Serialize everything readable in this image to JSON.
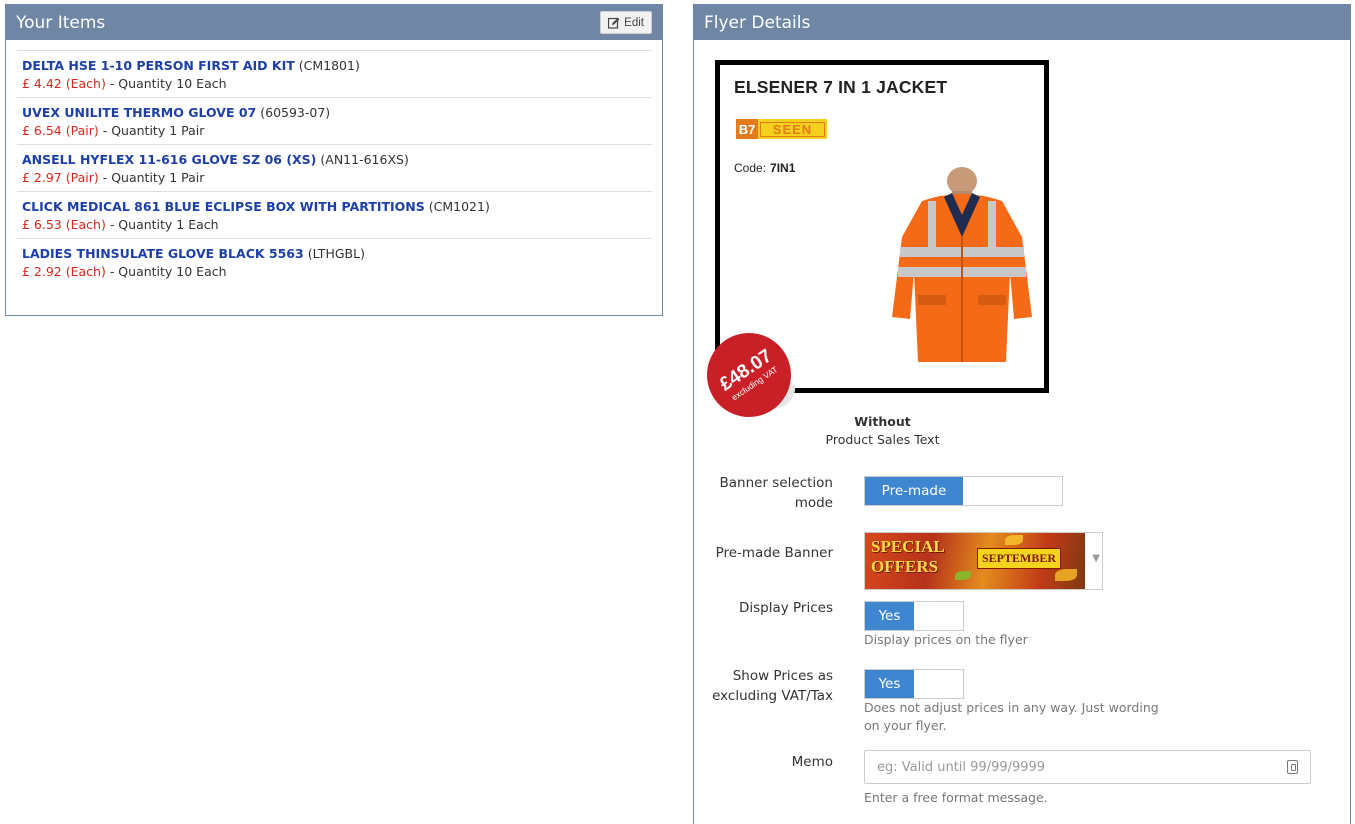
{
  "items_panel": {
    "title": "Your Items",
    "edit_label": "Edit",
    "items": [
      {
        "name": "DELTA HSE 1-10 PERSON FIRST AID KIT",
        "code": "(CM1801)",
        "price": "£ 4.42 (Each)",
        "qty": "- Quantity 10 Each"
      },
      {
        "name": "UVEX UNILITE THERMO GLOVE 07",
        "code": "(60593-07)",
        "price": "£ 6.54 (Pair)",
        "qty": "- Quantity 1 Pair"
      },
      {
        "name": "ANSELL HYFLEX 11-616 GLOVE SZ 06 (XS)",
        "code": "(AN11-616XS)",
        "price": "£ 2.97 (Pair)",
        "qty": "- Quantity 1 Pair"
      },
      {
        "name": "CLICK MEDICAL 861 BLUE ECLIPSE BOX WITH PARTITIONS",
        "code": "(CM1021)",
        "price": "£ 6.53 (Each)",
        "qty": "- Quantity 1 Each"
      },
      {
        "name": "LADIES THINSULATE GLOVE BLACK 5563",
        "code": "(LTHGBL)",
        "price": "£ 2.92 (Each)",
        "qty": "- Quantity 10 Each"
      }
    ]
  },
  "flyer_panel": {
    "title": "Flyer Details",
    "preview": {
      "product_title": "ELSENER 7 IN 1 JACKET",
      "logo_text": "SEEN",
      "logo_mark": "B7",
      "code_label": "Code:",
      "code_value": "7IN1",
      "price": "£48.07",
      "price_note": "excluding VAT"
    },
    "without_bold": "Without",
    "without_text": "Product Sales Text",
    "banner_mode": {
      "label_line1": "Banner selection",
      "label_line2": "mode",
      "value": "Pre-made"
    },
    "premade_banner": {
      "label": "Pre-made Banner",
      "text_special": "SPECIAL",
      "text_offers": "OFFERS",
      "text_month": "SEPTEMBER"
    },
    "display_prices": {
      "label": "Display Prices",
      "value": "Yes",
      "help": "Display prices on the flyer"
    },
    "show_excl_vat": {
      "label_line1": "Show Prices as",
      "label_line2": "excluding VAT/Tax",
      "value": "Yes",
      "help_line1": "Does not adjust prices in any way. Just wording",
      "help_line2": "on your flyer."
    },
    "memo": {
      "label": "Memo",
      "placeholder": "eg: Valid until 99/99/9999",
      "help": "Enter a free format message."
    }
  },
  "colors": {
    "panel_header": "#6f86a4",
    "link_blue": "#1d3fa8",
    "price_red": "#d9261c",
    "toggle_blue": "#3f86d0"
  }
}
